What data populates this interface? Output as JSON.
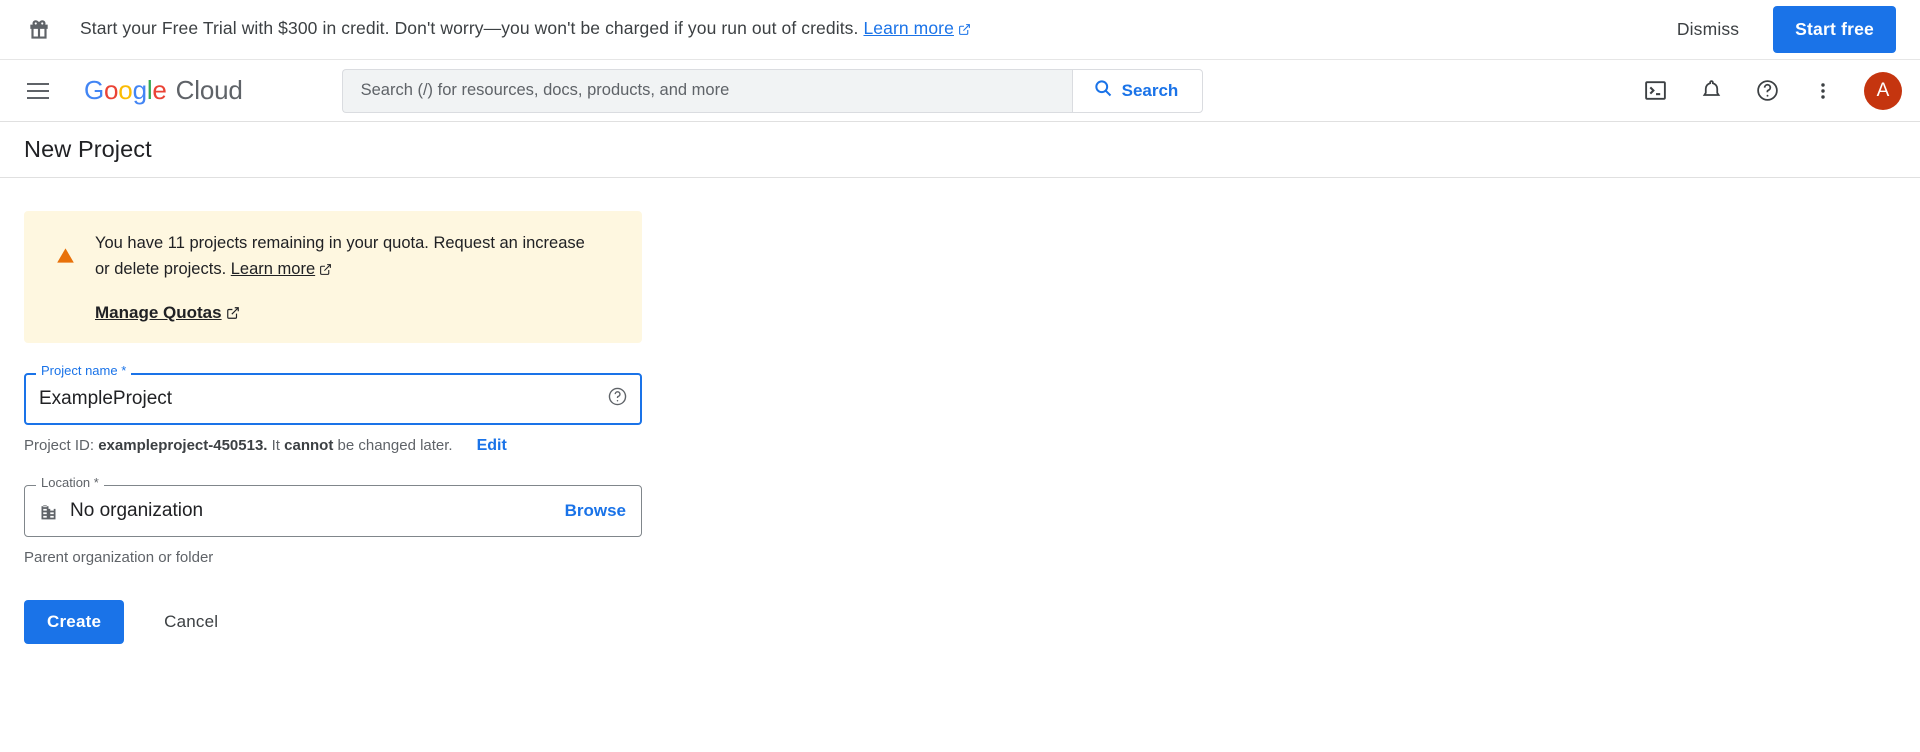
{
  "promo": {
    "icon": "gift-icon",
    "message_before_link": "Start your Free Trial with $300 in credit. Don't worry—you won't be charged if you run out of credits.",
    "link_label": "Learn more",
    "dismiss_label": "Dismiss",
    "start_free_label": "Start free",
    "accent_color": "#1a73e8"
  },
  "header": {
    "menu_icon": "hamburger-icon",
    "brand": {
      "g1": "G",
      "o1": "o",
      "o2": "o",
      "g2": "g",
      "l1": "l",
      "e1": "e",
      "product": "Cloud"
    },
    "search": {
      "placeholder": "Search (/) for resources, docs, products, and more",
      "value": "",
      "button_label": "Search",
      "button_color": "#1a73e8"
    },
    "icons": [
      "cloud-shell-icon",
      "notifications-bell-icon",
      "help-icon",
      "more-options-icon"
    ],
    "avatar_initial": "A",
    "avatar_color": "#c5350f"
  },
  "page": {
    "title": "New Project"
  },
  "quota_banner": {
    "icon": "warning-triangle-icon",
    "icon_color": "#e8710a",
    "background": "#fef7e0",
    "text_line1": "You have 11 projects remaining in your quota. Request an increase",
    "text_line2_before_link": "or delete projects.",
    "inline_link_label": "Learn more",
    "action_link_label": "Manage Quotas",
    "projects_remaining": 11
  },
  "form": {
    "project_name": {
      "label": "Project name *",
      "value": "ExampleProject",
      "focused": true,
      "help_icon": "help-circle-icon"
    },
    "project_id": {
      "prefix": "Project ID:",
      "id_value": "exampleproject-450513.",
      "middle_text": "It",
      "emphasis": "cannot",
      "suffix": "be changed later.",
      "edit_label": "Edit"
    },
    "location": {
      "label": "Location *",
      "icon": "organization-building-icon",
      "value": "No organization",
      "browse_label": "Browse",
      "helper_text": "Parent organization or folder"
    },
    "actions": {
      "create_label": "Create",
      "cancel_label": "Cancel",
      "create_color": "#1a73e8"
    }
  }
}
